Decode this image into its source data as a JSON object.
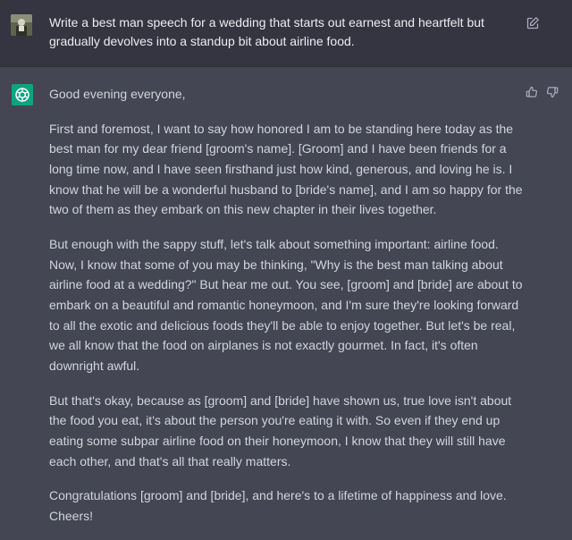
{
  "user_message": {
    "text": "Write a best man speech for a wedding that starts out earnest and heartfelt but gradually devolves into a standup bit about airline food.",
    "avatar_icon": "user-avatar-image",
    "edit_icon": "pencil-square-icon"
  },
  "assistant_message": {
    "avatar_icon": "openai-logo-icon",
    "paragraphs": [
      "Good evening everyone,",
      "First and foremost, I want to say how honored I am to be standing here today as the best man for my dear friend [groom's name]. [Groom] and I have been friends for a long time now, and I have seen firsthand just how kind, generous, and loving he is. I know that he will be a wonderful husband to [bride's name], and I am so happy for the two of them as they embark on this new chapter in their lives together.",
      "But enough with the sappy stuff, let's talk about something important: airline food. Now, I know that some of you may be thinking, \"Why is the best man talking about airline food at a wedding?\" But hear me out. You see, [groom] and [bride] are about to embark on a beautiful and romantic honeymoon, and I'm sure they're looking forward to all the exotic and delicious foods they'll be able to enjoy together. But let's be real, we all know that the food on airplanes is not exactly gourmet. In fact, it's often downright awful.",
      "But that's okay, because as [groom] and [bride] have shown us, true love isn't about the food you eat, it's about the person you're eating it with. So even if they end up eating some subpar airline food on their honeymoon, I know that they will still have each other, and that's all that really matters.",
      "Congratulations [groom] and [bride], and here's to a lifetime of happiness and love. Cheers!"
    ],
    "thumbs_up_icon": "thumbs-up-icon",
    "thumbs_down_icon": "thumbs-down-icon"
  },
  "colors": {
    "user_bg": "#343541",
    "assistant_bg": "#444654",
    "accent": "#10a37f",
    "text": "#d1d5db"
  }
}
